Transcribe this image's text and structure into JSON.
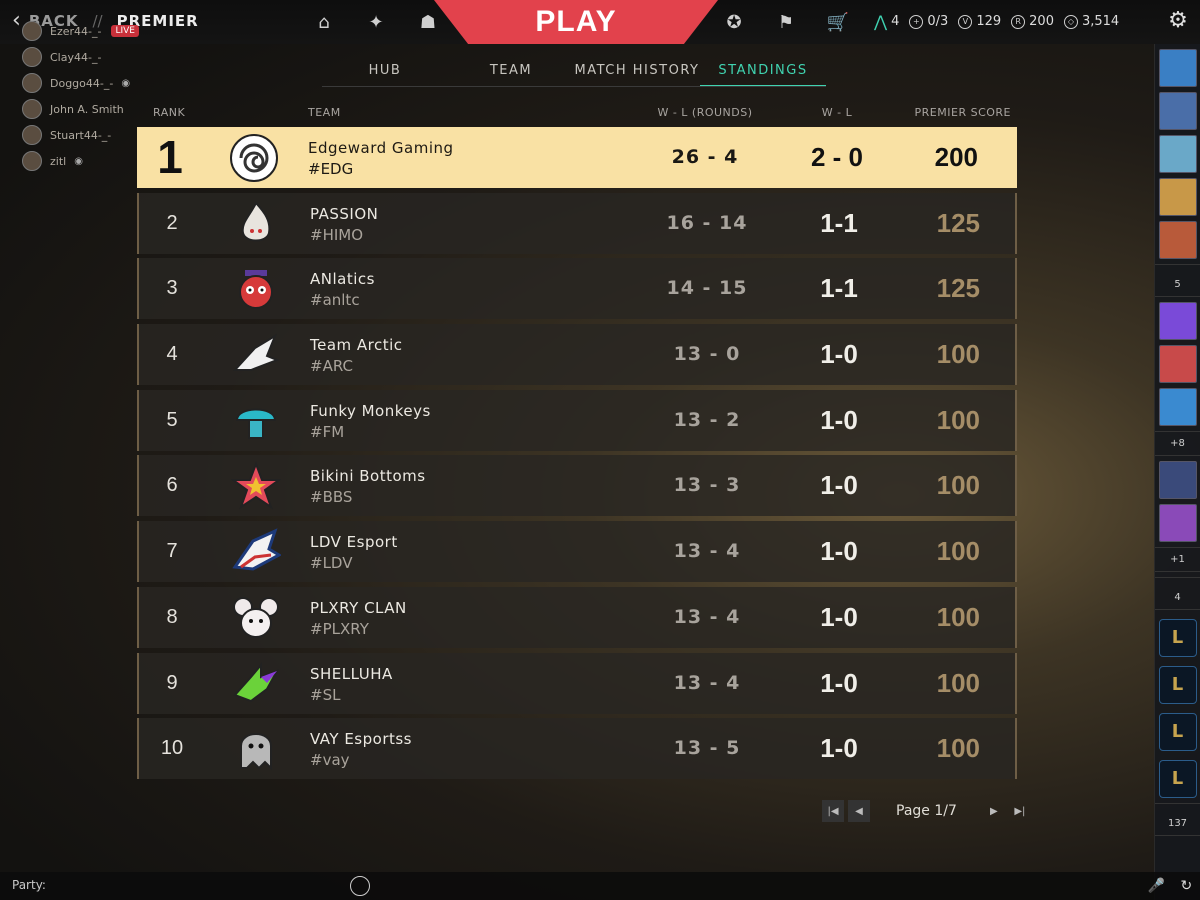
{
  "header": {
    "back_label": "BACK",
    "separator": "//",
    "section": "PREMIER",
    "play_label": "PLAY",
    "rank_progress": "4",
    "challenge_progress": "0/3",
    "vp": "129",
    "radianite": "200",
    "kingdom_credits": "3,514"
  },
  "friends_mini": [
    {
      "name": "Ezer44-_-",
      "live": "LIVE"
    },
    {
      "name": "Clay44-_-"
    },
    {
      "name": "Doggo44-_-"
    },
    {
      "name": "John A. Smith"
    },
    {
      "name": "Stuart44-_-"
    },
    {
      "name": "zitl"
    }
  ],
  "subtabs": [
    "HUB",
    "TEAM",
    "MATCH HISTORY",
    "STANDINGS"
  ],
  "table": {
    "headers": {
      "rank": "RANK",
      "team": "TEAM",
      "rounds": "W - L (ROUNDS)",
      "wl": "W - L",
      "score": "PREMIER SCORE"
    },
    "rows": [
      {
        "rank": "1",
        "name": "Edgeward Gaming",
        "tag": "#EDG",
        "rounds": "26 - 4",
        "wl": "2 - 0",
        "score": "200"
      },
      {
        "rank": "2",
        "name": "PASSION",
        "tag": "#HIMO",
        "rounds": "16 - 14",
        "wl": "1-1",
        "score": "125"
      },
      {
        "rank": "3",
        "name": "ANlatics",
        "tag": "#anltc",
        "rounds": "14 - 15",
        "wl": "1-1",
        "score": "125"
      },
      {
        "rank": "4",
        "name": "Team Arctic",
        "tag": "#ARC",
        "rounds": "13 - 0",
        "wl": "1-0",
        "score": "100"
      },
      {
        "rank": "5",
        "name": "Funky Monkeys",
        "tag": "#FM",
        "rounds": "13 - 2",
        "wl": "1-0",
        "score": "100"
      },
      {
        "rank": "6",
        "name": "Bikini Bottoms",
        "tag": "#BBS",
        "rounds": "13 - 3",
        "wl": "1-0",
        "score": "100"
      },
      {
        "rank": "7",
        "name": "LDV Esport",
        "tag": "#LDV",
        "rounds": "13 - 4",
        "wl": "1-0",
        "score": "100"
      },
      {
        "rank": "8",
        "name": "PLXRY CLAN",
        "tag": "#PLXRY",
        "rounds": "13 - 4",
        "wl": "1-0",
        "score": "100"
      },
      {
        "rank": "9",
        "name": "SHELLUHA",
        "tag": "#SL",
        "rounds": "13 - 4",
        "wl": "1-0",
        "score": "100"
      },
      {
        "rank": "10",
        "name": "VAY Esportss",
        "tag": "#vay",
        "rounds": "13 - 5",
        "wl": "1-0",
        "score": "100"
      }
    ]
  },
  "pager": {
    "label": "Page 1/7"
  },
  "right_rail": {
    "count1": "5",
    "plus1": "+8",
    "plus2": "+1",
    "count2": "4",
    "count3": "137"
  },
  "bottom": {
    "party_label": "Party:"
  },
  "colors": {
    "accent": "#40d3b0",
    "play_red": "#e2424c",
    "highlight_row": "#f9e1a4",
    "score_gold": "#a58d67"
  }
}
